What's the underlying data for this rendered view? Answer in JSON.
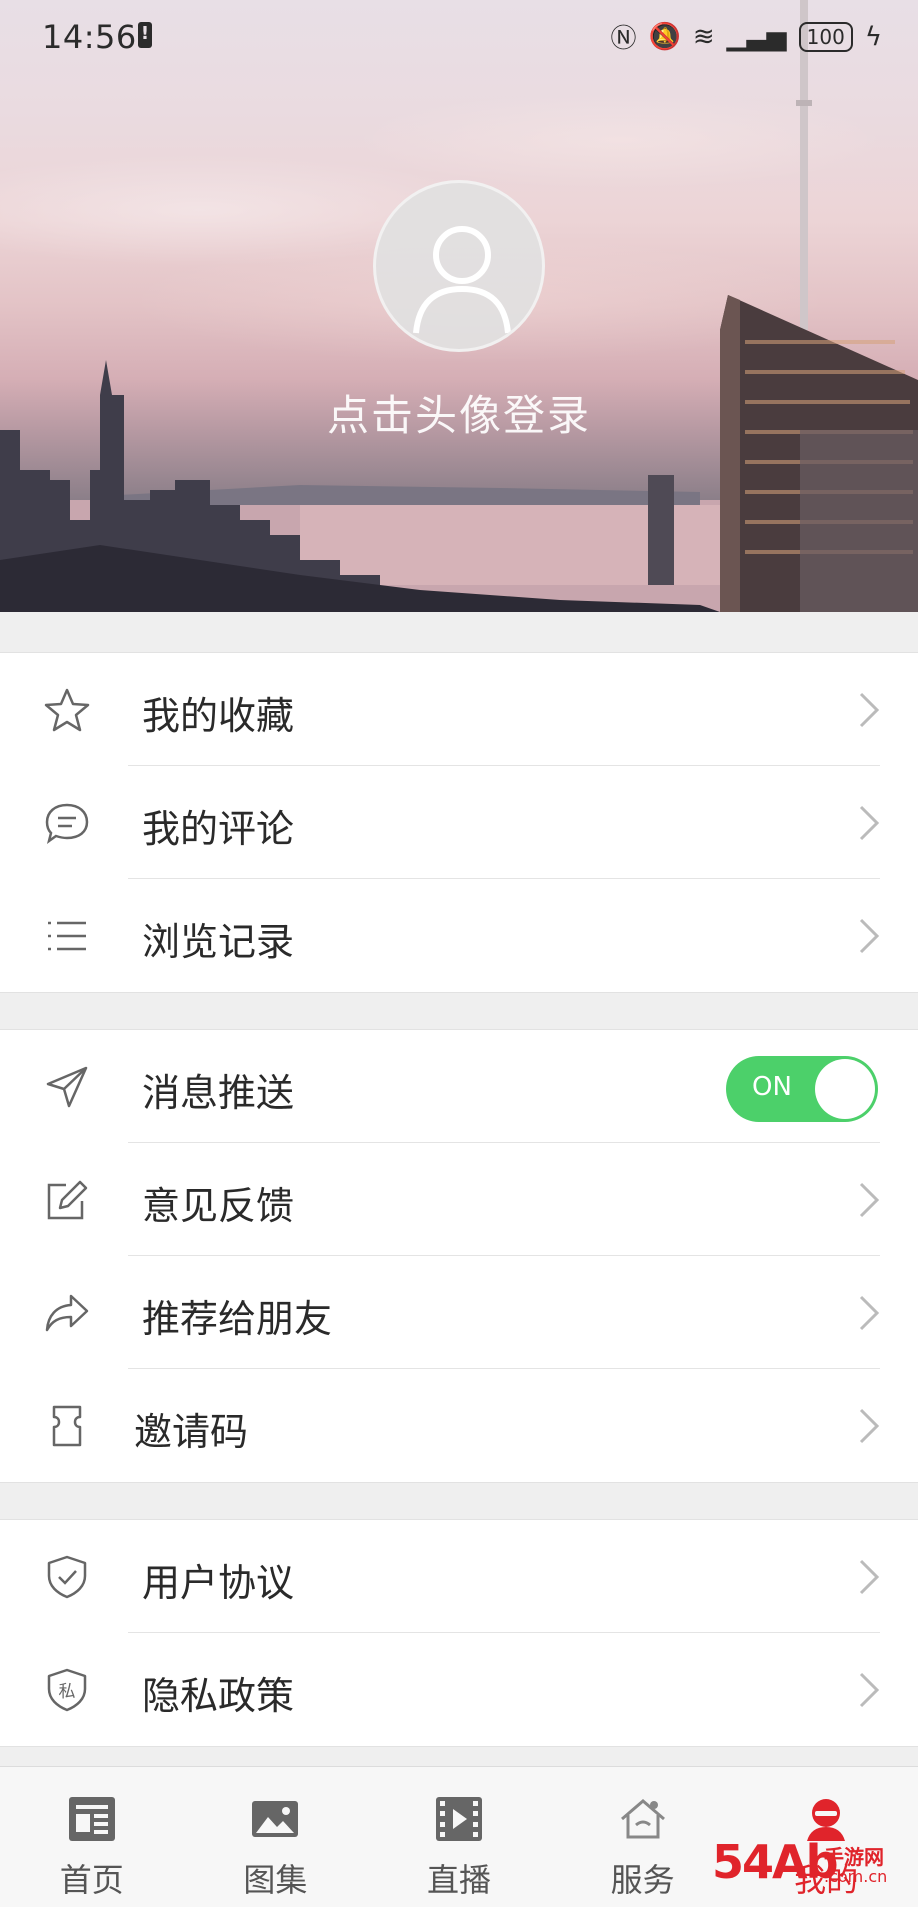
{
  "status_bar": {
    "time": "14:56",
    "battery": "100"
  },
  "profile": {
    "login_prompt": "点击头像登录"
  },
  "menu_group_1": [
    {
      "label": "我的收藏",
      "icon": "star-icon"
    },
    {
      "label": "我的评论",
      "icon": "comment-icon"
    },
    {
      "label": "浏览记录",
      "icon": "list-icon"
    }
  ],
  "menu_group_2": {
    "push": {
      "label": "消息推送",
      "icon": "send-icon",
      "toggle_text": "ON",
      "enabled": true
    },
    "items": [
      {
        "label": "意见反馈",
        "icon": "edit-icon"
      },
      {
        "label": "推荐给朋友",
        "icon": "share-icon"
      },
      {
        "label": "邀请码",
        "icon": "card-icon"
      }
    ]
  },
  "menu_group_3": [
    {
      "label": "用户协议",
      "icon": "shield-check-icon"
    },
    {
      "label": "隐私政策",
      "icon": "shield-private-icon",
      "icon_text": "私"
    }
  ],
  "tabbar": [
    {
      "label": "首页",
      "icon": "news-icon",
      "active": false
    },
    {
      "label": "图集",
      "icon": "image-icon",
      "active": false
    },
    {
      "label": "直播",
      "icon": "video-icon",
      "active": false
    },
    {
      "label": "服务",
      "icon": "house-icon",
      "active": false
    },
    {
      "label": "我的",
      "icon": "user-icon",
      "active": true
    }
  ],
  "watermark": {
    "big": "54Ab",
    "line1": "手游网",
    "line2": ".com.cn"
  },
  "colors": {
    "accent": "#e0242b",
    "toggle_on": "#4cd06a"
  }
}
